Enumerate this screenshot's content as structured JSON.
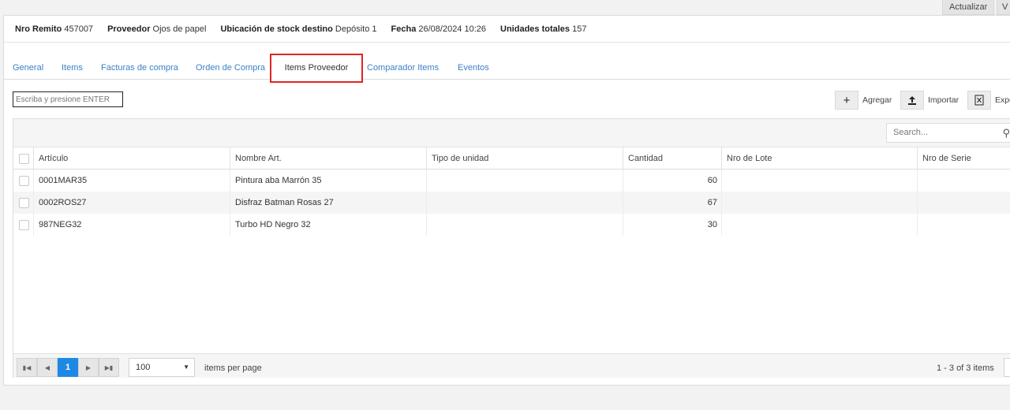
{
  "top_actions": {
    "update_label": "Actualizar",
    "next_label": "V"
  },
  "info": [
    {
      "label": "Nro Remito",
      "value": "457007"
    },
    {
      "label": "Proveedor",
      "value": "Ojos de papel"
    },
    {
      "label": "Ubicación de stock destino",
      "value": "Depósito 1"
    },
    {
      "label": "Fecha",
      "value": "26/08/2024 10:26"
    },
    {
      "label": "Unidades totales",
      "value": "157"
    }
  ],
  "tabs": [
    {
      "label": "General",
      "active": false
    },
    {
      "label": "Items",
      "active": false
    },
    {
      "label": "Facturas de compra",
      "active": false
    },
    {
      "label": "Orden de Compra",
      "active": false
    },
    {
      "label": "Items Proveedor",
      "active": true
    },
    {
      "label": "Comparador Items",
      "active": false
    },
    {
      "label": "Eventos",
      "active": false
    }
  ],
  "search_enter": {
    "placeholder": "Escriba y presione ENTER"
  },
  "toolbar": {
    "add_label": "Agregar",
    "add_icon": "plus-icon",
    "import_label": "Importar",
    "import_icon": "upload-icon",
    "export_label": "Expo",
    "export_icon": "excel-icon"
  },
  "grid": {
    "search_placeholder": "Search...",
    "columns": [
      "Artículo",
      "Nombre Art.",
      "Tipo de unidad",
      "Cantidad",
      "Nro de Lote",
      "Nro de Serie"
    ],
    "rows": [
      {
        "articulo": "0001MAR35",
        "nombre": "Pintura aba Marrón 35",
        "tipo": "",
        "cantidad": "60",
        "lote": "",
        "serie": ""
      },
      {
        "articulo": "0002ROS27",
        "nombre": "Disfraz Batman Rosas 27",
        "tipo": "",
        "cantidad": "67",
        "lote": "",
        "serie": ""
      },
      {
        "articulo": "987NEG32",
        "nombre": "Turbo HD Negro 32",
        "tipo": "",
        "cantidad": "30",
        "lote": "",
        "serie": ""
      }
    ]
  },
  "pager": {
    "current_page": "1",
    "page_size": "100",
    "per_page_label": "items per page",
    "info": "1 - 3 of 3 items"
  },
  "colors": {
    "accent": "#1e88e5",
    "link": "#3b82c4",
    "highlight": "#e02424"
  }
}
